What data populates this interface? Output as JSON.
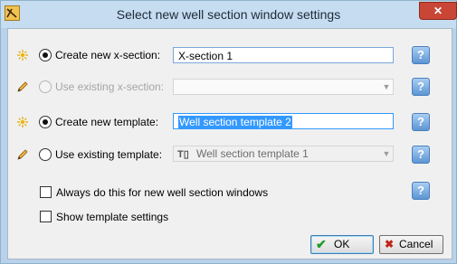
{
  "window": {
    "title": "Select new well section window settings",
    "close_glyph": "✕"
  },
  "xsection": {
    "create_label": "Create new x-section:",
    "create_value": "X-section 1",
    "create_selected": true,
    "use_existing_label": "Use existing x-section:",
    "use_existing_value": "",
    "use_existing_enabled": false
  },
  "template": {
    "create_label": "Create new template:",
    "create_value": "Well section template 2",
    "create_selected": true,
    "use_existing_label": "Use existing template:",
    "use_existing_value": "Well section template 1",
    "use_existing_icon": "T▯"
  },
  "options": {
    "always_label": "Always do this for new well section windows",
    "always_checked": false,
    "show_settings_label": "Show template settings",
    "show_settings_checked": false
  },
  "buttons": {
    "ok_label": "OK",
    "ok_icon": "✔",
    "cancel_label": "Cancel",
    "cancel_icon": "✖"
  },
  "help_glyph": "?",
  "dropdown_arrow": "▼",
  "icons": {
    "new_item": "sparkle-icon",
    "existing_item": "pencil-icon",
    "app": "app-icon",
    "help": "question-mark-icon"
  },
  "colors": {
    "accent_blue": "#3399ff",
    "ok_check": "#1f9a2a",
    "cancel_x": "#c0241b",
    "close_red": "#c94636"
  }
}
